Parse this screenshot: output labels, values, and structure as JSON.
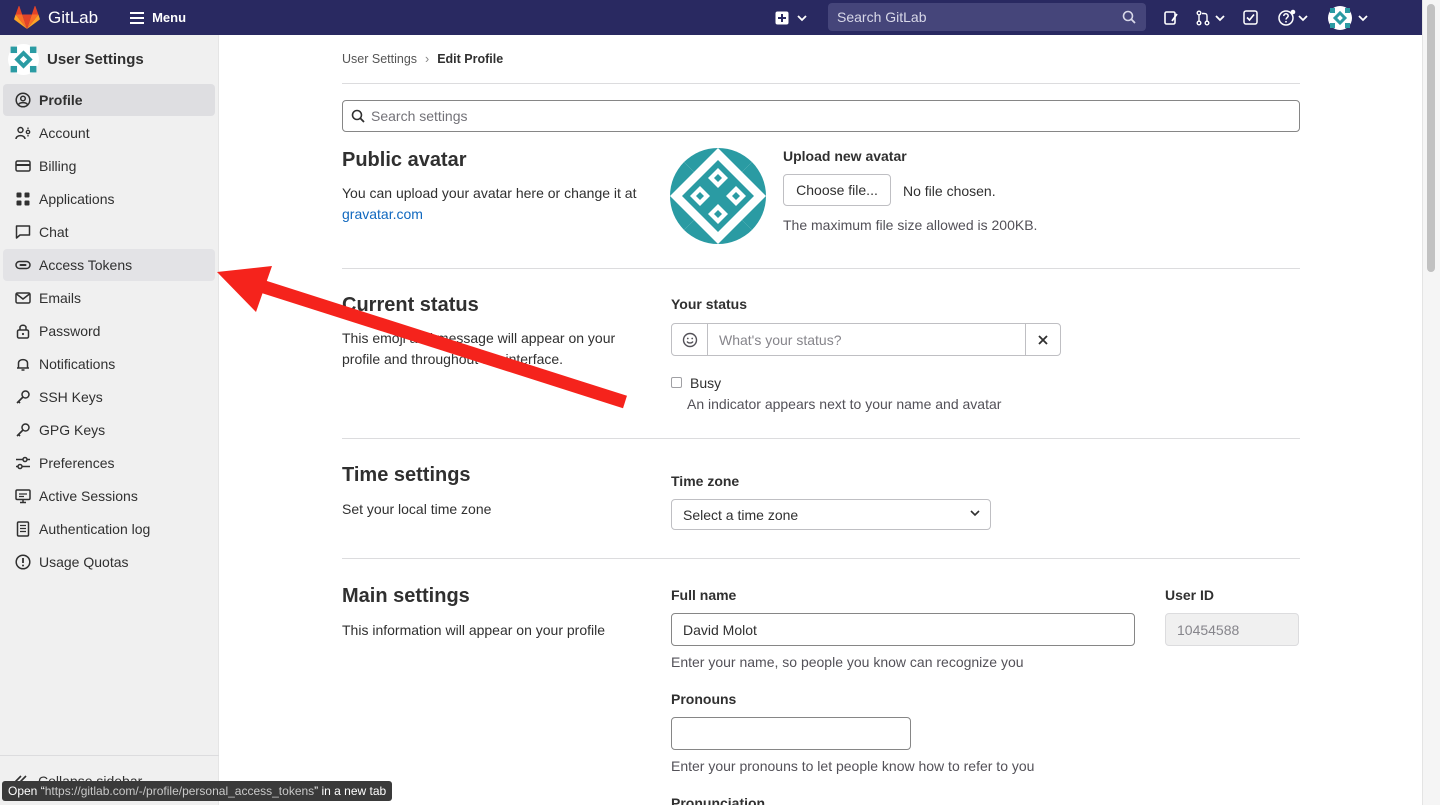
{
  "header": {
    "brand": "GitLab",
    "menu_label": "Menu",
    "search_placeholder": "Search GitLab",
    "icons": [
      "plus-square-icon",
      "chevron-down-icon",
      "search-icon",
      "issues-icon",
      "merge-request-icon",
      "todo-icon",
      "help-icon",
      "user-avatar"
    ]
  },
  "sidebar": {
    "title": "User Settings",
    "items": [
      {
        "label": "Profile",
        "icon": "profile-icon",
        "active": true
      },
      {
        "label": "Account",
        "icon": "account-icon"
      },
      {
        "label": "Billing",
        "icon": "billing-icon"
      },
      {
        "label": "Applications",
        "icon": "applications-icon"
      },
      {
        "label": "Chat",
        "icon": "chat-icon"
      },
      {
        "label": "Access Tokens",
        "icon": "token-icon",
        "hover": true
      },
      {
        "label": "Emails",
        "icon": "mail-icon"
      },
      {
        "label": "Password",
        "icon": "lock-icon"
      },
      {
        "label": "Notifications",
        "icon": "bell-icon"
      },
      {
        "label": "SSH Keys",
        "icon": "key-icon"
      },
      {
        "label": "GPG Keys",
        "icon": "key-icon"
      },
      {
        "label": "Preferences",
        "icon": "preferences-icon"
      },
      {
        "label": "Active Sessions",
        "icon": "monitor-icon"
      },
      {
        "label": "Authentication log",
        "icon": "log-icon"
      },
      {
        "label": "Usage Quotas",
        "icon": "quota-icon"
      }
    ],
    "collapse_label": "Collapse sidebar"
  },
  "statusbar": {
    "prefix": "Open “",
    "url": "https://gitlab.com/-/profile/personal_access_tokens",
    "suffix": "” in a new tab"
  },
  "breadcrumb": {
    "parent": "User Settings",
    "current": "Edit Profile"
  },
  "search_settings_placeholder": "Search settings",
  "avatar_section": {
    "title": "Public avatar",
    "desc": "You can upload your avatar here or change it at",
    "link": "gravatar.com",
    "upload_label": "Upload new avatar",
    "choose_button": "Choose file...",
    "no_file": "No file chosen.",
    "max_size_help": "The maximum file size allowed is 200KB."
  },
  "status_section": {
    "title": "Current status",
    "desc": "This emoji and message will appear on your profile and throughout the interface.",
    "label": "Your status",
    "placeholder": "What's your status?",
    "busy_label": "Busy",
    "busy_help": "An indicator appears next to your name and avatar"
  },
  "time_section": {
    "title": "Time settings",
    "desc": "Set your local time zone",
    "label": "Time zone",
    "select_value": "Select a time zone"
  },
  "main_section": {
    "title": "Main settings",
    "desc": "This information will appear on your profile",
    "fullname_label": "Full name",
    "fullname_value": "David Molot",
    "fullname_help": "Enter your name, so people you know can recognize you",
    "userid_label": "User ID",
    "userid_value": "10454588",
    "pronouns_label": "Pronouns",
    "pronouns_value": "",
    "pronouns_help": "Enter your pronouns to let people know how to refer to you",
    "pronunciation_label": "Pronunciation"
  },
  "colors": {
    "topbar": "#292961",
    "link": "#1068bf",
    "annotation_arrow": "#f5231c",
    "avatar_teal": "#2a9ba3"
  }
}
